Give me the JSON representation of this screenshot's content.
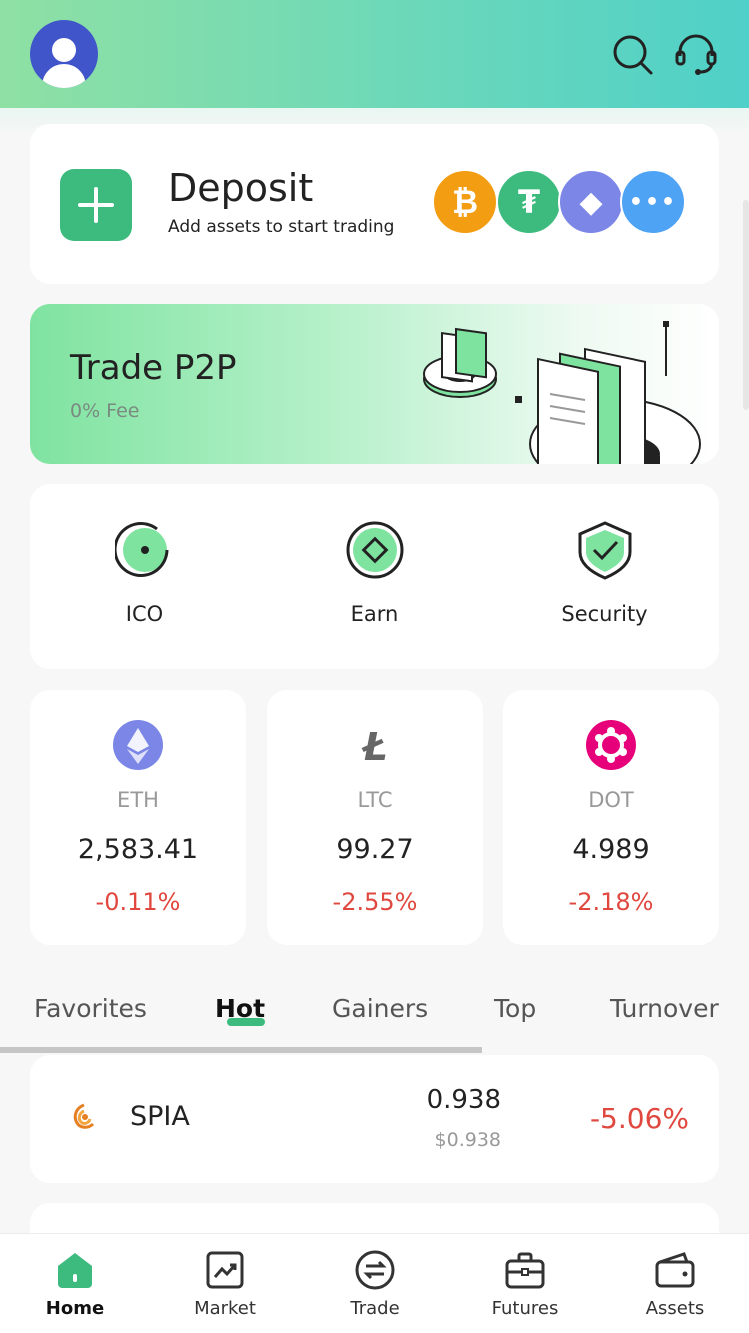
{
  "header": {
    "avatar_icon": "user-avatar-icon",
    "search_icon": "search-icon",
    "support_icon": "headset-icon"
  },
  "deposit": {
    "title": "Deposit",
    "subtitle": "Add assets to start trading",
    "coins": [
      {
        "name": "bitcoin-icon",
        "color": "#f29d12",
        "glyph": "₿"
      },
      {
        "name": "tether-icon",
        "color": "#3dbb7e",
        "glyph": "₮"
      },
      {
        "name": "ethereum-icon",
        "color": "#7b86e6",
        "glyph": "◆"
      },
      {
        "name": "more-icon",
        "color": "#4ea3f5",
        "glyph": "•••"
      }
    ]
  },
  "p2p": {
    "title": "Trade P2P",
    "subtitle": "0% Fee"
  },
  "quick_actions": [
    {
      "label": "ICO",
      "icon": "ico-icon"
    },
    {
      "label": "Earn",
      "icon": "earn-icon"
    },
    {
      "label": "Security",
      "icon": "shield-check-icon"
    }
  ],
  "tickers": [
    {
      "symbol": "ETH",
      "price": "2,583.41",
      "change": "-0.11%",
      "color": "#7b86e6"
    },
    {
      "symbol": "LTC",
      "price": "99.27",
      "change": "-2.55%",
      "color": "#666666"
    },
    {
      "symbol": "DOT",
      "price": "4.989",
      "change": "-2.18%",
      "color": "#e6007a"
    }
  ],
  "market_tabs": {
    "items": [
      "Favorites",
      "Hot",
      "Gainers",
      "Top",
      "Turnover"
    ],
    "active": "Hot"
  },
  "market_rows": [
    {
      "name": "SPIA",
      "price": "0.938",
      "usd": "$0.938",
      "change": "-5.06%"
    }
  ],
  "bottom_nav": [
    {
      "label": "Home",
      "icon": "home-icon",
      "active": true
    },
    {
      "label": "Market",
      "icon": "chart-icon"
    },
    {
      "label": "Trade",
      "icon": "swap-icon"
    },
    {
      "label": "Futures",
      "icon": "briefcase-icon"
    },
    {
      "label": "Assets",
      "icon": "wallet-icon"
    }
  ],
  "colors": {
    "accent": "#3dbb7e",
    "negative": "#e0483f",
    "header_gradient_start": "#8fe0a3",
    "header_gradient_end": "#4fd0c8"
  }
}
